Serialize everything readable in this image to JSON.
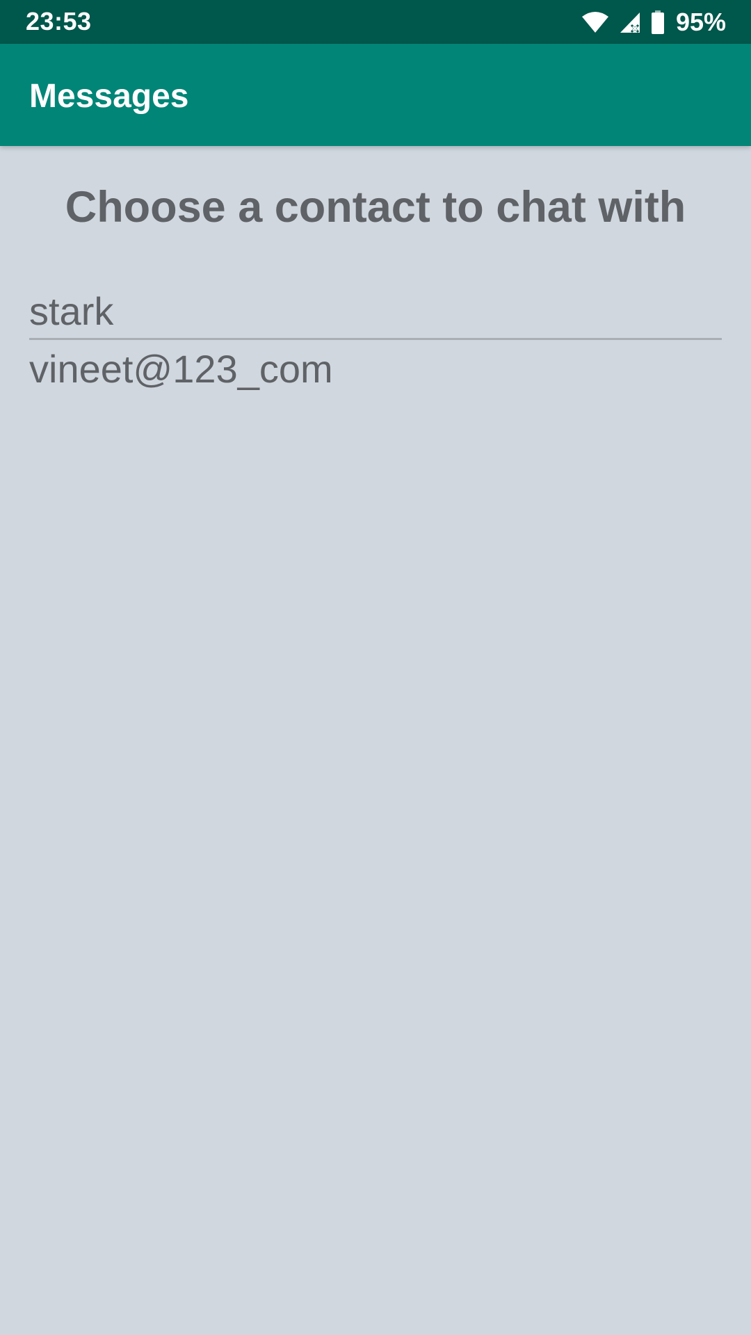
{
  "status_bar": {
    "time": "23:53",
    "battery": "95%",
    "icons": [
      "wifi-icon",
      "signal-icon",
      "battery-icon"
    ]
  },
  "app_bar": {
    "title": "Messages"
  },
  "main": {
    "heading": "Choose a contact to chat with",
    "contacts": [
      {
        "name": "stark"
      },
      {
        "name": "vineet@123_com"
      }
    ]
  },
  "colors": {
    "status_bar": "#00574b",
    "app_bar": "#008577",
    "background": "#d0d7df",
    "text": "#5f6266"
  }
}
